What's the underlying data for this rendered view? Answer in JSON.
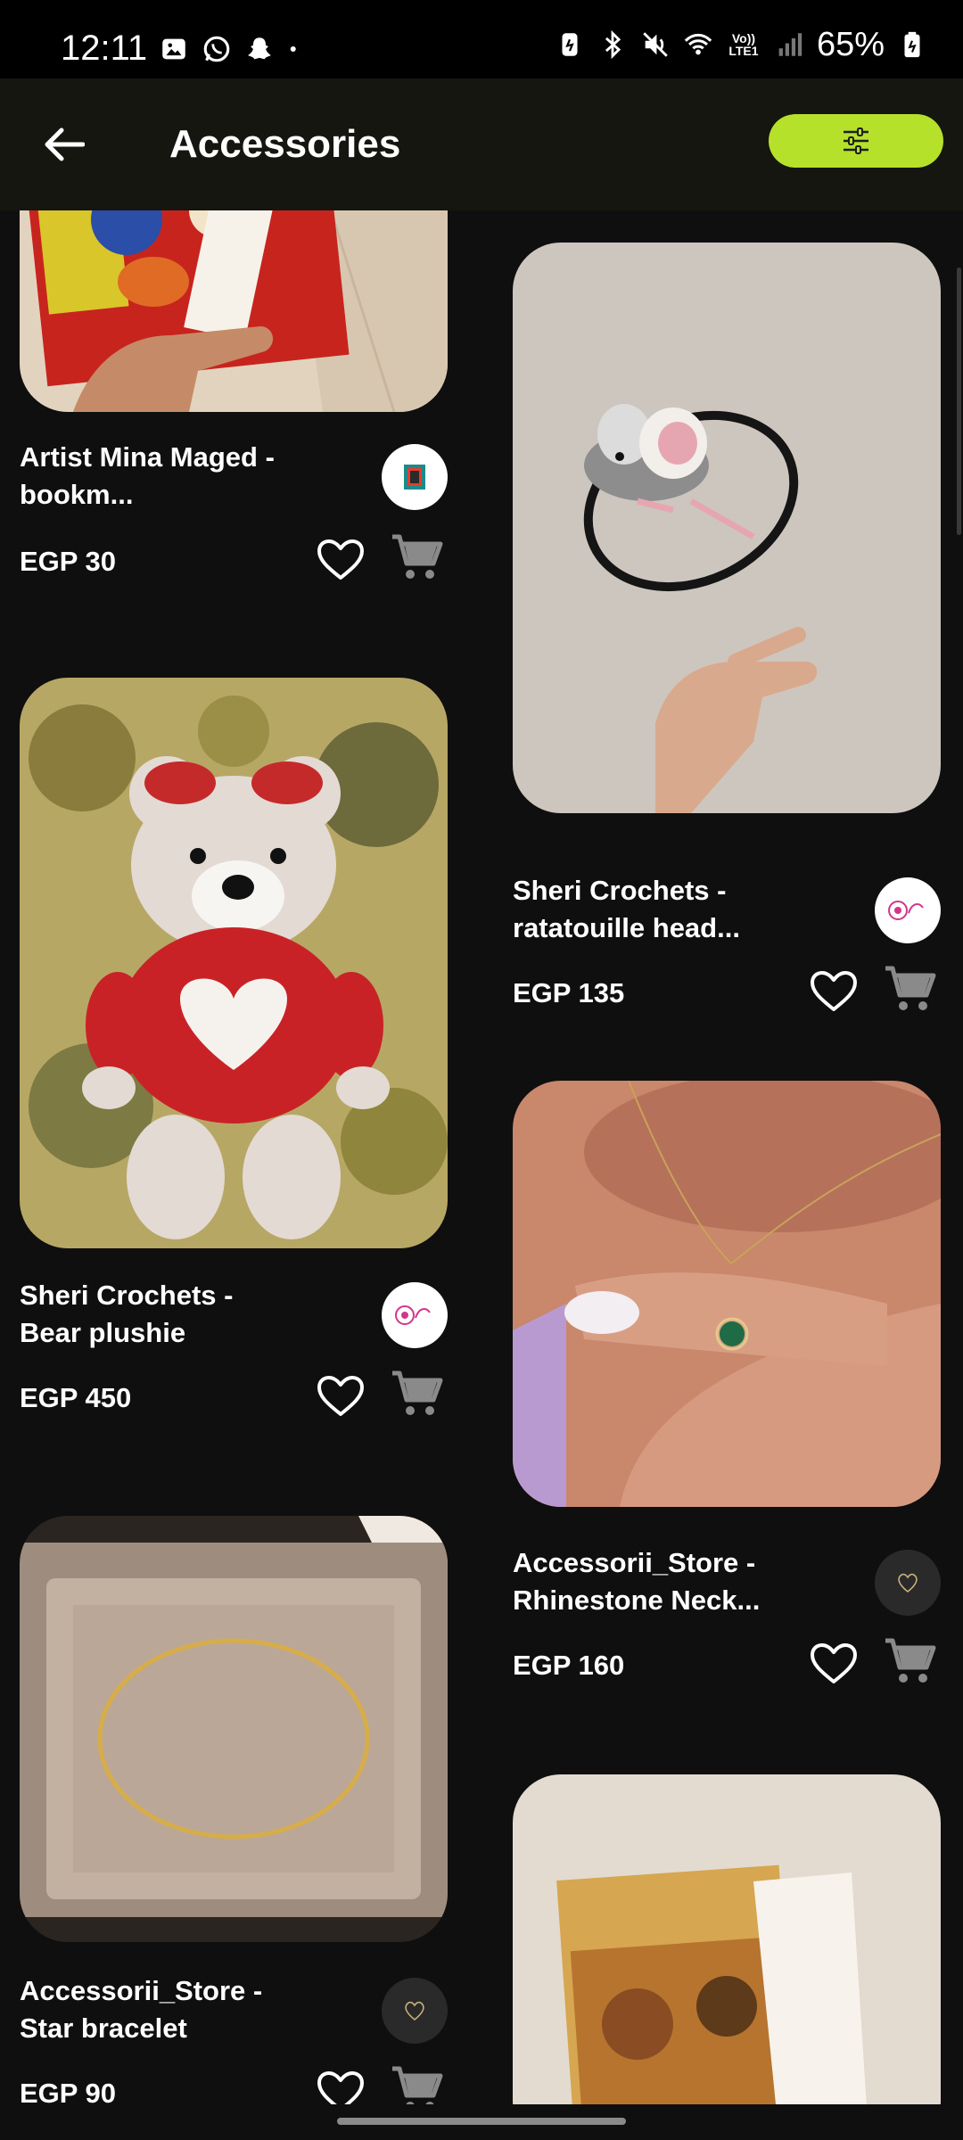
{
  "status_bar": {
    "time": "12:11",
    "battery": "65%",
    "lte_label": "Vo)) LTE1",
    "left_icons": [
      "gallery-icon",
      "whatsapp-icon",
      "snapchat-icon",
      "dot-icon"
    ],
    "right_icons": [
      "battery-saver-icon",
      "bluetooth-icon",
      "mute-icon",
      "wifi-icon",
      "signal-icon",
      "battery-icon"
    ]
  },
  "header": {
    "title": "Accessories",
    "back_icon": "arrow-left-icon",
    "filter_icon": "sliders-icon",
    "accent": "#b6e12b"
  },
  "products": [
    {
      "title": "Artist Mina Maged  - bookm...",
      "price": "EGP 30",
      "store": "Artist Mina Maged",
      "image": "bookmark-cartoon"
    },
    {
      "title": "Sheri Crochets - ratatouille head...",
      "price": "EGP 135",
      "store": "Sheri Crochets",
      "image": "crochet-mouse-headband"
    },
    {
      "title": "Sheri Crochets - Bear plushie",
      "price": "EGP 450",
      "store": "Sheri Crochets",
      "image": "crochet-bear"
    },
    {
      "title": "Accessorii_Store - Rhinestone Neck...",
      "price": "EGP 160",
      "store": "Accessorii_Store",
      "image": "necklace"
    },
    {
      "title": "Accessorii_Store - Star bracelet",
      "price": "EGP 90",
      "store": "Accessorii_Store",
      "image": "star-bracelet"
    },
    {
      "title": "",
      "price": "",
      "store": "",
      "image": "book-bookmark"
    }
  ]
}
